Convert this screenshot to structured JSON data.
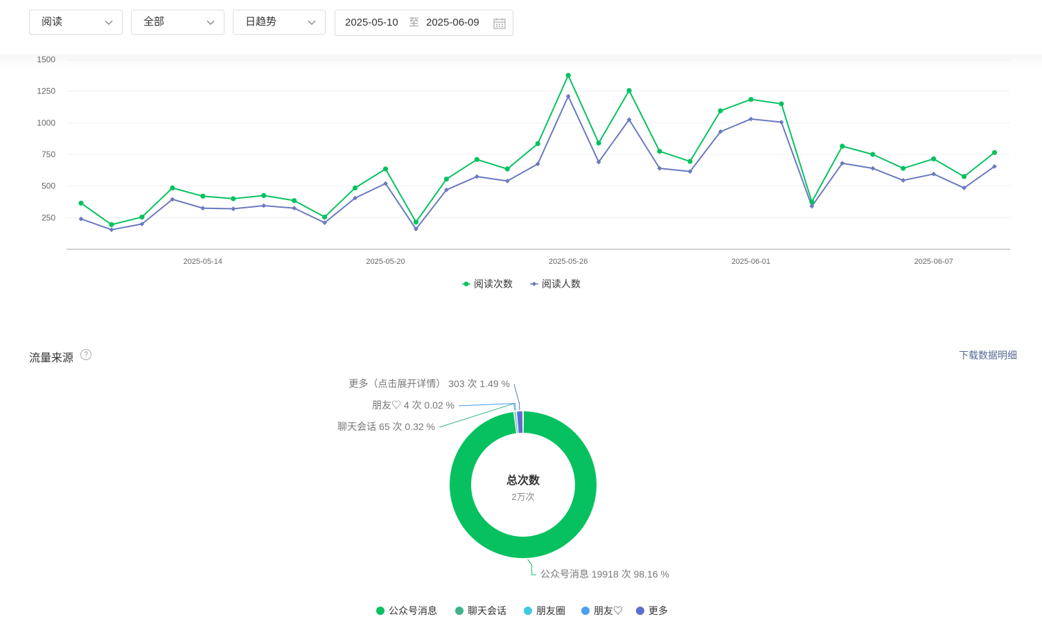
{
  "filters": {
    "metric": "阅读",
    "scope": "全部",
    "period": "日趋势",
    "date_start": "2025-05-10",
    "date_sep": "至",
    "date_end": "2025-06-09"
  },
  "icons": {
    "dropdown": "chevron-down-icon",
    "calendar": "calendar-icon",
    "help": "question-circle-icon"
  },
  "colors": {
    "read_count": "#07c160",
    "reader_count": "#6a79bf",
    "accent_link": "#576b95"
  },
  "chart_data": [
    {
      "type": "line",
      "x": [
        "2025-05-10",
        "2025-05-11",
        "2025-05-12",
        "2025-05-13",
        "2025-05-14",
        "2025-05-15",
        "2025-05-16",
        "2025-05-17",
        "2025-05-18",
        "2025-05-19",
        "2025-05-20",
        "2025-05-21",
        "2025-05-22",
        "2025-05-23",
        "2025-05-24",
        "2025-05-25",
        "2025-05-26",
        "2025-05-27",
        "2025-05-28",
        "2025-05-29",
        "2025-05-30",
        "2025-05-31",
        "2025-06-01",
        "2025-06-02",
        "2025-06-03",
        "2025-06-04",
        "2025-06-05",
        "2025-06-06",
        "2025-06-07",
        "2025-06-08",
        "2025-06-09"
      ],
      "x_tick_labels": [
        "2025-05-14",
        "2025-05-20",
        "2025-05-26",
        "2025-06-01",
        "2025-06-07"
      ],
      "y_ticks": [
        250,
        500,
        750,
        1000,
        1250,
        1500
      ],
      "ylim": [
        0,
        1500
      ],
      "grid": true,
      "legend": "bottom-center",
      "series": [
        {
          "name": "阅读次数",
          "marker": "circle",
          "color": "#07c160",
          "values": [
            365,
            195,
            255,
            485,
            420,
            400,
            425,
            385,
            255,
            485,
            635,
            215,
            555,
            710,
            635,
            835,
            1375,
            840,
            1255,
            775,
            695,
            1095,
            1185,
            1150,
            375,
            815,
            750,
            640,
            715,
            575,
            765
          ]
        },
        {
          "name": "阅读人数",
          "marker": "diamond",
          "color": "#6a79bf",
          "values": [
            240,
            155,
            200,
            395,
            325,
            320,
            345,
            325,
            210,
            405,
            520,
            160,
            470,
            575,
            540,
            675,
            1210,
            690,
            1025,
            640,
            615,
            930,
            1030,
            1005,
            340,
            680,
            640,
            545,
            595,
            485,
            655
          ]
        }
      ]
    },
    {
      "type": "pie",
      "variant": "donut",
      "center_title": "总次数",
      "center_value": "2万次",
      "legend": "bottom-center",
      "slices": [
        {
          "name": "公众号消息",
          "label": "公众号消息 19918 次 98.16 %",
          "value": 19918,
          "percent": 98.16,
          "color": "#07c160"
        },
        {
          "name": "聊天会话",
          "label": "聊天会话 65 次 0.32 %",
          "value": 65,
          "percent": 0.32,
          "color": "#3db589"
        },
        {
          "name": "朋友圈",
          "value": 0,
          "percent": 0,
          "color": "#40c9e5"
        },
        {
          "name": "朋友♡",
          "label": "朋友♡ 4 次 0.02 %",
          "value": 4,
          "percent": 0.02,
          "color": "#4c9ff0"
        },
        {
          "name": "更多",
          "label": "更多（点击展开详情） 303 次 1.49 %",
          "value": 303,
          "percent": 1.49,
          "color": "#5d6fcc"
        }
      ]
    }
  ],
  "traffic": {
    "title": "流量来源",
    "help": "?",
    "download_label": "下载数据明细"
  }
}
